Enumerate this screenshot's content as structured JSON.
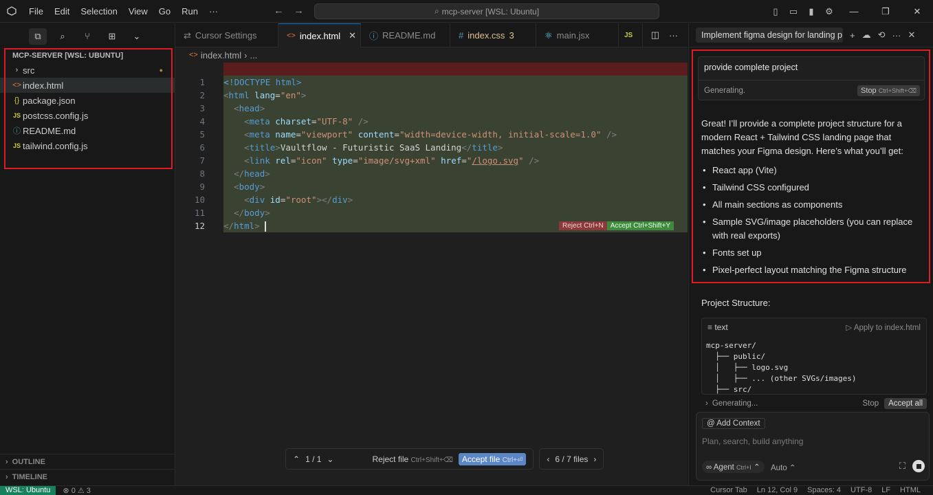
{
  "menu": [
    "File",
    "Edit",
    "Selection",
    "View",
    "Go",
    "Run",
    "···"
  ],
  "search": {
    "text": "mcp-server [WSL: Ubuntu]"
  },
  "explorer": {
    "title": "MCP-SERVER [WSL: UBUNTU]",
    "items": [
      {
        "label": "src",
        "icon": "›"
      },
      {
        "label": "index.html",
        "icon": "<>"
      },
      {
        "label": "package.json",
        "icon": "{}"
      },
      {
        "label": "postcss.config.js",
        "icon": "JS"
      },
      {
        "label": "README.md",
        "icon": "ⓘ"
      },
      {
        "label": "tailwind.config.js",
        "icon": "JS"
      }
    ],
    "outline": "OUTLINE",
    "timeline": "TIMELINE"
  },
  "tabs": [
    {
      "label": "Cursor Settings",
      "icon": "⇄"
    },
    {
      "label": "index.html",
      "icon": "<>"
    },
    {
      "label": "README.md",
      "icon": "ⓘ"
    },
    {
      "label": "index.css",
      "icon": "#",
      "badge": "3"
    },
    {
      "label": "main.jsx",
      "icon": "⚛"
    },
    {
      "label": "JS",
      "icon": ""
    }
  ],
  "breadcrumb": {
    "file": "index.html",
    "rest": "..."
  },
  "code_lines": [
    "1",
    "2",
    "3",
    "4",
    "5",
    "6",
    "7",
    "8",
    "9",
    "10",
    "11",
    "12"
  ],
  "code_text": {
    "l1": "<!DOCTYPE html>",
    "html_tag": "html",
    "lang_attr": "lang",
    "lang_val": "\"en\"",
    "head": "head",
    "meta": "meta",
    "charset_attr": "charset",
    "charset_val": "\"UTF-8\"",
    "name_attr": "name",
    "name_val": "\"viewport\"",
    "content_attr": "content",
    "content_val": "\"width=device-width, initial-scale=1.0\"",
    "title": "title",
    "title_text": "Vaultflow - Futuristic SaaS Landing",
    "link": "link",
    "rel_attr": "rel",
    "rel_val": "\"icon\"",
    "type_attr": "type",
    "type_val": "\"image/svg+xml\"",
    "href_attr": "href",
    "href_val": "/logo.svg",
    "body": "body",
    "div": "div",
    "id_attr": "id",
    "id_val": "\"root\""
  },
  "inline_actions": {
    "reject": "Reject Ctrl+N",
    "accept": "Accept Ctrl+Shift+Y"
  },
  "review_bar": {
    "nav": "1 / 1",
    "reject": "Reject file",
    "reject_kb": "Ctrl+Shift+⌫",
    "accept": "Accept file",
    "accept_kb": "Ctrl+⏎",
    "files": "6 / 7 files"
  },
  "chat": {
    "tab_title": "Implement figma design for landing p",
    "prompt": "provide complete project",
    "generating": "Generating.",
    "stop": "Stop",
    "stop_kb": "Ctrl+Shift+⌫",
    "response": "Great! I’ll provide a complete project structure for a modern React + Tailwind CSS landing page that matches your Figma design. Here’s what you’ll get:",
    "bullets": [
      "React app (Vite)",
      "Tailwind CSS configured",
      "All main sections as components",
      "Sample SVG/image placeholders (you can replace with real exports)",
      "Fonts set up",
      "Pixel-perfect layout matching the Figma structure"
    ],
    "project_structure": "Project Structure:",
    "codeblock_lang": "text",
    "apply": "▷ Apply to index.html",
    "tree": "mcp-server/\n  ├── public/\n  │   ├── logo.svg\n  │   ├── ... (other SVGs/images)\n  ├── src/",
    "gen_row": "Generating...",
    "gen_stop": "Stop",
    "accept_all": "Accept all",
    "add_context": "@ Add Context",
    "placeholder": "Plan, search, build anything",
    "agent": "∞ Agent",
    "agent_kb": "Ctrl+I",
    "auto": "Auto"
  },
  "status": {
    "wsl": "WSL: Ubuntu",
    "problems": "⊗ 0 ⚠ 3",
    "cursor_tab": "Cursor Tab",
    "position": "Ln 12, Col 9",
    "spaces": "Spaces: 4",
    "encoding": "UTF-8",
    "eol": "LF",
    "lang": "HTML"
  },
  "colors": {
    "highlight_red": "#e01b24",
    "accent": "#0078d4",
    "added_bg": "#3a4232"
  }
}
